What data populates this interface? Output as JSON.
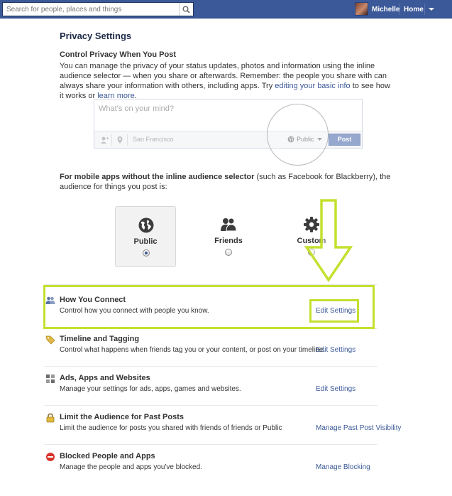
{
  "topbar": {
    "search_placeholder": "Search for people, places and things",
    "user_name": "Michelle",
    "home_label": "Home"
  },
  "page": {
    "title": "Privacy Settings",
    "section_title": "Control Privacy When You Post",
    "intro_text_1": "You can manage the privacy of your status updates, photos and information using the inline audience selector — when you share or afterwards. Remember: the people you share with can always share your information with others, including apps. Try ",
    "intro_link_1": "editing your basic info",
    "intro_text_2": " to see how it works or ",
    "intro_link_2": "learn more",
    "intro_text_3": "."
  },
  "composer": {
    "placeholder": "What's on your mind?",
    "location": "San Francisco",
    "audience": "Public",
    "post_label": "Post"
  },
  "mobile": {
    "bold": "For mobile apps without the inline audience selector",
    "text": " (such as Facebook for Blackberry), the audience for things you post is:"
  },
  "audience_options": [
    {
      "label": "Public",
      "selected": true
    },
    {
      "label": "Friends",
      "selected": false
    },
    {
      "label": "Custom",
      "selected": false
    }
  ],
  "settings_rows": [
    {
      "title": "How You Connect",
      "desc": "Control how you connect with people you know.",
      "link": "Edit Settings"
    },
    {
      "title": "Timeline and Tagging",
      "desc": "Control what happens when friends tag you or your content, or post on your timeline.",
      "link": "Edit Settings"
    },
    {
      "title": "Ads, Apps and Websites",
      "desc": "Manage your settings for ads, apps, games and websites.",
      "link": "Edit Settings"
    },
    {
      "title": "Limit the Audience for Past Posts",
      "desc": "Limit the audience for posts you shared with friends of friends or Public",
      "link": "Manage Past Post Visibility"
    },
    {
      "title": "Blocked People and Apps",
      "desc": "Manage the people and apps you've blocked.",
      "link": "Manage Blocking"
    }
  ],
  "colors": {
    "brand": "#3b5998",
    "highlight": "#c5e02e"
  }
}
